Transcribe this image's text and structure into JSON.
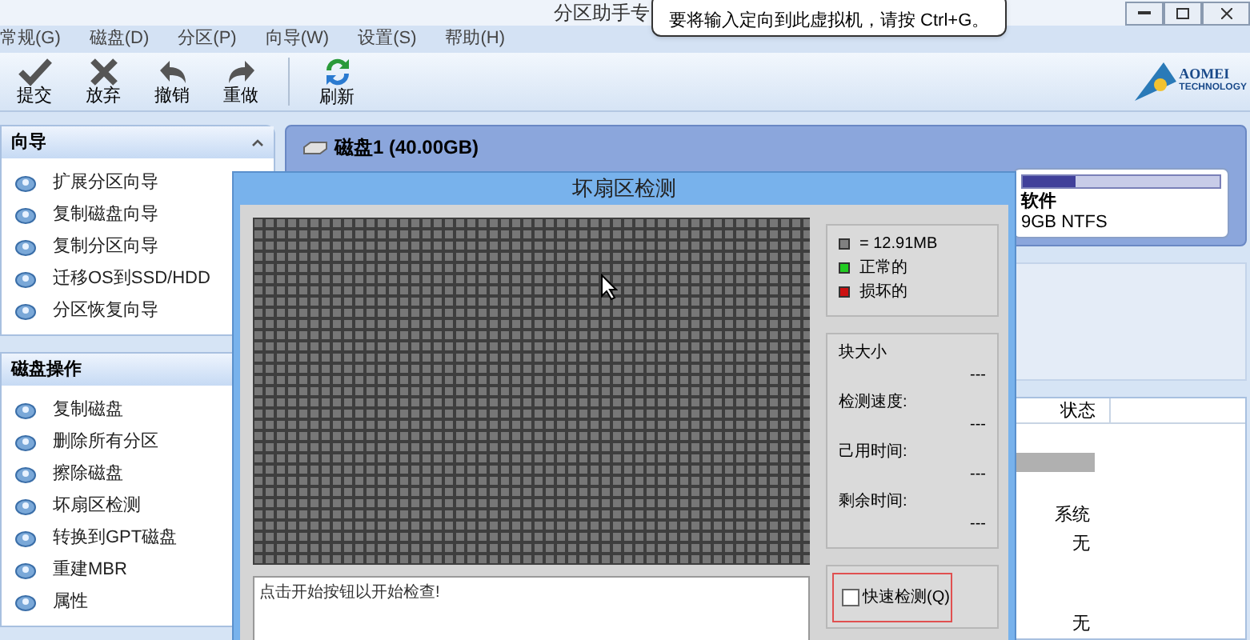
{
  "window": {
    "title": "分区助手专"
  },
  "tooltip": "要将输入定向到此虚拟机，请按 Ctrl+G。",
  "menu": [
    "常规(G)",
    "磁盘(D)",
    "分区(P)",
    "向导(W)",
    "设置(S)",
    "帮助(H)"
  ],
  "toolbar": [
    {
      "label": "提交",
      "kind": "check"
    },
    {
      "label": "放弃",
      "kind": "cross"
    },
    {
      "label": "撤销",
      "kind": "undo"
    },
    {
      "label": "重做",
      "kind": "redo"
    },
    {
      "label": "刷新",
      "kind": "refresh"
    }
  ],
  "logo": {
    "name": "AOMEI",
    "sub": "TECHNOLOGY"
  },
  "sidebar": {
    "sections": [
      {
        "title": "向导",
        "expanded": true,
        "items": [
          "扩展分区向导",
          "复制磁盘向导",
          "复制分区向导",
          "迁移OS到SSD/HDD",
          "分区恢复向导"
        ]
      },
      {
        "title": "磁盘操作",
        "items": [
          "复制磁盘",
          "删除所有分区",
          "擦除磁盘",
          "坏扇区检测",
          "转换到GPT磁盘",
          "重建MBR",
          "属性"
        ]
      }
    ]
  },
  "disk": {
    "title": "磁盘1 (40.00GB)",
    "partition": {
      "name": "软件",
      "info": "9GB NTFS",
      "level": 0.27
    }
  },
  "table": {
    "columns": [
      "状态"
    ],
    "rows": [
      {
        "kind": "blank"
      },
      {
        "kind": "group"
      },
      {
        "kind": "blank"
      },
      {
        "kind": "text",
        "status": "系统"
      },
      {
        "kind": "text",
        "status": "无"
      },
      {
        "kind": "blank"
      },
      {
        "kind": "blank"
      },
      {
        "kind": "text",
        "status": "无"
      }
    ]
  },
  "dialog": {
    "title": "坏扇区检测",
    "legend": [
      {
        "label": "= 12.91MB",
        "color": "#808080"
      },
      {
        "label": "正常的",
        "color": "#22cc22"
      },
      {
        "label": "损坏的",
        "color": "#cc1111"
      }
    ],
    "stats": [
      {
        "label": "块大小",
        "value": "---"
      },
      {
        "label": "检测速度:",
        "value": "---"
      },
      {
        "label": "己用时间:",
        "value": "---"
      },
      {
        "label": "剩余时间:",
        "value": "---"
      }
    ],
    "log": "点击开始按钮以开始检查!",
    "quick_check": {
      "label": "快速检测(Q)",
      "checked": false
    }
  }
}
